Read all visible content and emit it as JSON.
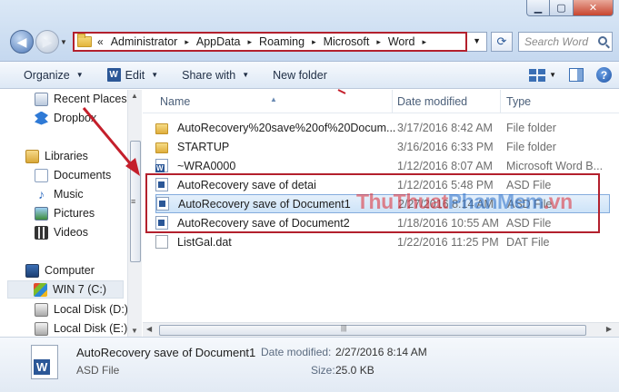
{
  "window": {
    "min_icon": "minimize-icon",
    "max_icon": "maximize-icon",
    "close_icon": "close-icon"
  },
  "address": {
    "start": "«",
    "crumbs": [
      "Administrator",
      "AppData",
      "Roaming",
      "Microsoft",
      "Word"
    ],
    "separator": "▸"
  },
  "search": {
    "placeholder": "Search Word"
  },
  "toolbar": {
    "organize": "Organize",
    "edit": "Edit",
    "share": "Share with",
    "new_folder": "New folder"
  },
  "nav": {
    "recent": "Recent Places",
    "dropbox": "Dropbox",
    "libraries": "Libraries",
    "documents": "Documents",
    "music": "Music",
    "pictures": "Pictures",
    "videos": "Videos",
    "computer": "Computer",
    "win7": "WIN 7 (C:)",
    "disk_d": "Local Disk (D:)",
    "disk_e": "Local Disk (E:)"
  },
  "columns": {
    "name": "Name",
    "date": "Date modified",
    "type": "Type"
  },
  "files": [
    {
      "name": "AutoRecovery%20save%20of%20Docum...",
      "date": "3/17/2016 8:42 AM",
      "type": "File folder",
      "icon": "folder-icon"
    },
    {
      "name": "STARTUP",
      "date": "3/16/2016 6:33 PM",
      "type": "File folder",
      "icon": "folder-icon"
    },
    {
      "name": "~WRA0000",
      "date": "1/12/2016 8:07 AM",
      "type": "Microsoft Word B...",
      "icon": "word-doc-icon"
    },
    {
      "name": "AutoRecovery save of detai",
      "date": "1/12/2016 5:48 PM",
      "type": "ASD File",
      "icon": "asd-file-icon"
    },
    {
      "name": "AutoRecovery save of Document1",
      "date": "2/27/2016 8:14 AM",
      "type": "ASD File",
      "icon": "asd-file-icon"
    },
    {
      "name": "AutoRecovery save of Document2",
      "date": "1/18/2016 10:55 AM",
      "type": "ASD File",
      "icon": "asd-file-icon"
    },
    {
      "name": "ListGal.dat",
      "date": "1/22/2016 11:25 PM",
      "type": "DAT File",
      "icon": "dat-file-icon"
    }
  ],
  "watermark": {
    "a": "ThuThuat",
    "b": "PhanMem",
    "c": ".vn"
  },
  "details": {
    "name": "AutoRecovery save of Document1",
    "type": "ASD File",
    "date_label": "Date modified:",
    "date_value": "2/27/2016 8:14 AM",
    "size_label": "Size:",
    "size_value": "25.0 KB"
  },
  "colors": {
    "highlight_box": "#b3202d",
    "accent": "#2b5797"
  }
}
